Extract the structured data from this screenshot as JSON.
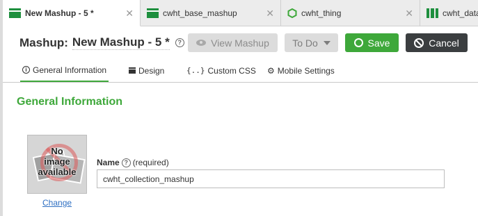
{
  "colors": {
    "accent": "#3ea83a",
    "cancel_bg": "#3b3e40",
    "tab_icon": "#1e8f3e",
    "link": "#2e6fc2"
  },
  "tabs": [
    {
      "label": "New Mashup - 5 *",
      "icon": "mashup-icon",
      "active": true
    },
    {
      "label": "cwht_base_mashup",
      "icon": "mashup-icon",
      "active": false
    },
    {
      "label": "cwht_thing",
      "icon": "thing-icon",
      "active": false
    },
    {
      "label": "cwht_data",
      "icon": "data-table-icon",
      "active": false
    }
  ],
  "tab_close_glyph": "✕",
  "header": {
    "prefix": "Mashup:",
    "name": "New Mashup - 5 *",
    "help_glyph": "?",
    "buttons": {
      "view": "View Mashup",
      "todo": "To Do",
      "save": "Save",
      "cancel": "Cancel"
    }
  },
  "subtabs": [
    {
      "label": "General Information",
      "icon": "info-icon",
      "active": true
    },
    {
      "label": "Design",
      "icon": "design-icon",
      "active": false
    },
    {
      "label": "Custom CSS",
      "icon": "css-icon",
      "icon_glyph": "{..}",
      "active": false
    },
    {
      "label": "Mobile Settings",
      "icon": "gear-icon",
      "icon_glyph": "⚙",
      "active": false
    }
  ],
  "general": {
    "section_title": "General Information",
    "thumbnail_text": "No\nimage\navailable",
    "change_link": "Change",
    "name_label": "Name",
    "name_required": "(required)",
    "name_value": "cwht_collection_mashup"
  }
}
